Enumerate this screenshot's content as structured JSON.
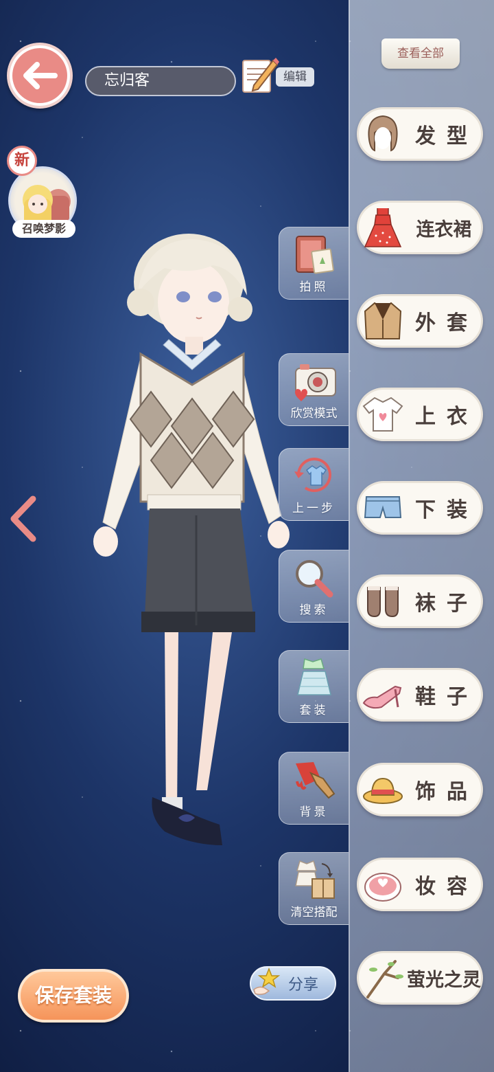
{
  "header": {
    "character_name": "忘归客",
    "edit_label": "编辑"
  },
  "summon": {
    "new_badge": "新",
    "label": "召唤梦影"
  },
  "view_all_label": "查看全部",
  "categories": [
    {
      "label": "发型",
      "icon": "hair-icon"
    },
    {
      "label": "连衣裙",
      "icon": "dress-icon"
    },
    {
      "label": "外套",
      "icon": "coat-icon"
    },
    {
      "label": "上衣",
      "icon": "shirt-icon"
    },
    {
      "label": "下装",
      "icon": "shorts-icon"
    },
    {
      "label": "袜子",
      "icon": "socks-icon"
    },
    {
      "label": "鞋子",
      "icon": "heels-icon"
    },
    {
      "label": "饰品",
      "icon": "hat-icon"
    },
    {
      "label": "妆容",
      "icon": "makeup-icon"
    },
    {
      "label": "萤光之灵",
      "icon": "branch-icon"
    }
  ],
  "side_tools": [
    {
      "label": "拍照",
      "icon": "album-icon"
    },
    {
      "label": "欣赏模式",
      "icon": "camera-icon"
    },
    {
      "label": "上一步",
      "icon": "undo-icon"
    },
    {
      "label": "搜索",
      "icon": "magnifier-icon"
    },
    {
      "label": "套装",
      "icon": "outfit-icon"
    },
    {
      "label": "背景",
      "icon": "paintbrush-icon"
    },
    {
      "label": "清空搭配",
      "icon": "clear-box-icon"
    }
  ],
  "save_label": "保存套装",
  "share_label": "分享",
  "colors": {
    "accent_pink": "#e98b86",
    "save_orange": "#f5945a",
    "panel_text": "#4a3f3c"
  }
}
